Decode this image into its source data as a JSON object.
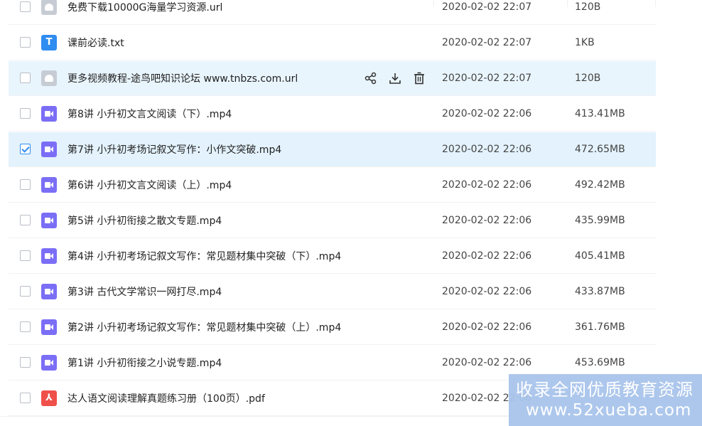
{
  "files": [
    {
      "name": "免费下载10000G海量学习资源.url",
      "date": "2020-02-02 22:07",
      "size": "120B",
      "type": "url"
    },
    {
      "name": "课前必读.txt",
      "date": "2020-02-02 22:07",
      "size": "1KB",
      "type": "txt",
      "icon_letter": "T"
    },
    {
      "name": "更多视频教程-途鸟吧知识论坛 www.tnbzs.com.url",
      "date": "2020-02-02 22:07",
      "size": "120B",
      "type": "url"
    },
    {
      "name": "第8讲 小升初文言文阅读（下）.mp4",
      "date": "2020-02-02 22:06",
      "size": "413.41MB",
      "type": "video"
    },
    {
      "name": "第7讲 小升初考场记叙文写作：小作文突破.mp4",
      "date": "2020-02-02 22:06",
      "size": "472.65MB",
      "type": "video"
    },
    {
      "name": "第6讲 小升初文言文阅读（上）.mp4",
      "date": "2020-02-02 22:06",
      "size": "492.42MB",
      "type": "video"
    },
    {
      "name": "第5讲 小升初衔接之散文专题.mp4",
      "date": "2020-02-02 22:06",
      "size": "435.99MB",
      "type": "video"
    },
    {
      "name": "第4讲 小升初考场记叙文写作：常见题材集中突破（下）.mp4",
      "date": "2020-02-02 22:06",
      "size": "405.41MB",
      "type": "video"
    },
    {
      "name": "第3讲 古代文学常识一网打尽.mp4",
      "date": "2020-02-02 22:06",
      "size": "433.87MB",
      "type": "video"
    },
    {
      "name": "第2讲 小升初考场记叙文写作：常见题材集中突破（上）.mp4",
      "date": "2020-02-02 22:06",
      "size": "361.76MB",
      "type": "video"
    },
    {
      "name": "第1讲 小升初衔接之小说专题.mp4",
      "date": "2020-02-02 22:06",
      "size": "453.69MB",
      "type": "video"
    },
    {
      "name": "达人语文阅读理解真题练习册（100页）.pdf",
      "date": "2020-02-02 22:06",
      "size": "",
      "type": "pdf"
    }
  ],
  "row_actions": {
    "share_icon": "share-icon",
    "download_icon": "download-icon",
    "delete_icon": "trash-icon"
  },
  "watermark": {
    "line1": "收录全网优质教育资源",
    "line2": "www.52xueba.com"
  },
  "colors": {
    "accent": "#2f8cf0",
    "video": "#7b6ef6",
    "pdf": "#f0504a",
    "hover_row": "#e9f5fd"
  }
}
